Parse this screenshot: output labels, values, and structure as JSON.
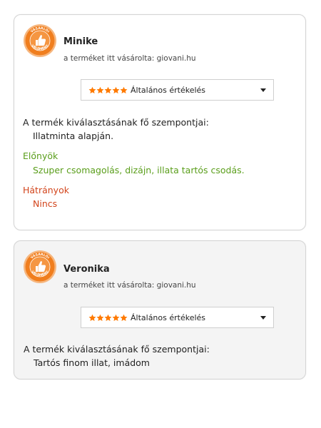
{
  "colors": {
    "pros": "#5a9e1b",
    "cons": "#d2441b",
    "star": "#ff7a00",
    "badge": "#f07e1e",
    "card_alt_background": "#f4f4f4"
  },
  "badge": {
    "icon": "thumbs-up-icon",
    "top_text": "VÁSÁRLÓI",
    "bottom_text": "VÉLEMÉNY"
  },
  "reviews": [
    {
      "name": "Minike",
      "purchase_info": "a terméket itt vásárolta: giovani.hu",
      "rating": {
        "stars": 5,
        "max_stars": 5,
        "label": "Általános értékelés"
      },
      "criteria_heading": "A termék kiválasztásának fő szempontjai:",
      "criteria_value": "Illatminta alapján.",
      "pros_heading": "Előnyök",
      "pros_value": "Szuper csomagolás, dizájn, illata tartós csodás.",
      "cons_heading": "Hátrányok",
      "cons_value": "Nincs"
    },
    {
      "name": "Veronika",
      "purchase_info": "a terméket itt vásárolta: giovani.hu",
      "rating": {
        "stars": 5,
        "max_stars": 5,
        "label": "Általános értékelés"
      },
      "criteria_heading": "A termék kiválasztásának fő szempontjai:",
      "criteria_value": "Tartós finom illat, imádom"
    }
  ]
}
